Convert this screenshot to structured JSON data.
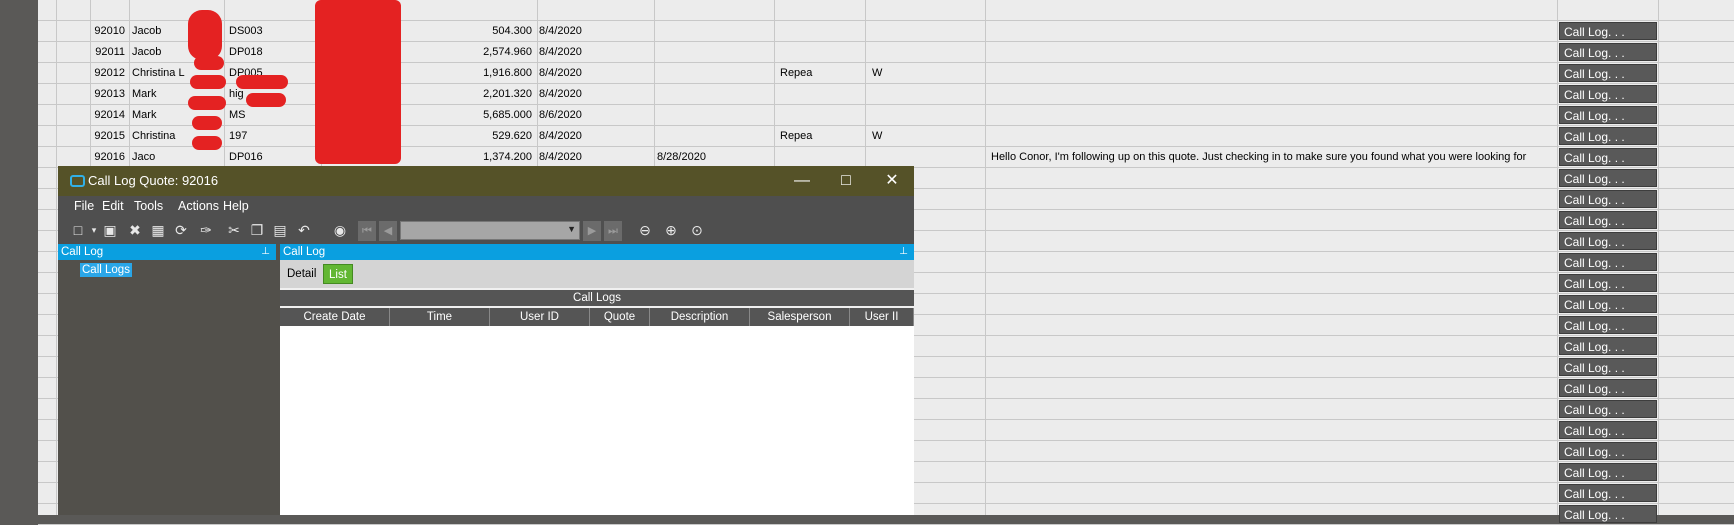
{
  "rows": [
    {
      "quote": "92010",
      "name": "Jacob",
      "code": "DS003",
      "amount": "504.300",
      "date": "8/4/2020",
      "date2": "",
      "col3": "",
      "col4": "",
      "note": ""
    },
    {
      "quote": "92011",
      "name": "Jacob",
      "code": "DP018",
      "amount": "2,574.960",
      "date": "8/4/2020",
      "date2": "",
      "col3": "",
      "col4": "",
      "note": ""
    },
    {
      "quote": "92012",
      "name": "Christina L",
      "code": "DP005",
      "amount": "1,916.800",
      "date": "8/4/2020",
      "date2": "",
      "col3": "Repea",
      "col4": "W",
      "note": ""
    },
    {
      "quote": "92013",
      "name": "Mark",
      "code": "hig",
      "amount": "2,201.320",
      "date": "8/4/2020",
      "date2": "",
      "col3": "",
      "col4": "",
      "note": ""
    },
    {
      "quote": "92014",
      "name": "Mark",
      "code": "MS",
      "amount": "5,685.000",
      "date": "8/6/2020",
      "date2": "",
      "col3": "",
      "col4": "",
      "note": ""
    },
    {
      "quote": "92015",
      "name": "Christina",
      "code": "197",
      "amount": "529.620",
      "date": "8/4/2020",
      "date2": "",
      "col3": "Repea",
      "col4": "W",
      "note": ""
    },
    {
      "quote": "92016",
      "name": "Jaco",
      "code": "DP016",
      "amount": "1,374.200",
      "date": "8/4/2020",
      "date2": "8/28/2020",
      "col3": "",
      "col4": "",
      "note": "Hello Conor, I'm following up on this quote. Just checking in to make sure you found what you were looking for"
    }
  ],
  "call_log_button_label": "Call Log. . .",
  "dialog": {
    "title": "Call Log  Quote:  92016",
    "menu": [
      "File",
      "Edit",
      "Tools",
      "Actions",
      "Help"
    ],
    "left_pane_title": "Call Log",
    "tree_item": "Call Logs",
    "right_pane_title": "Call Log",
    "tabs": [
      {
        "label": "Detail"
      },
      {
        "label": "List"
      }
    ],
    "active_tab": "List",
    "grid_title": "Call Logs",
    "columns": [
      "Create Date",
      "Time",
      "User ID",
      "Quote",
      "Description",
      "Salesperson",
      "User II"
    ]
  },
  "colors": {
    "title_bar": "#555228",
    "pane_header": "#0a9fe0",
    "active_tab": "#62b733",
    "redaction": "#e42222"
  }
}
